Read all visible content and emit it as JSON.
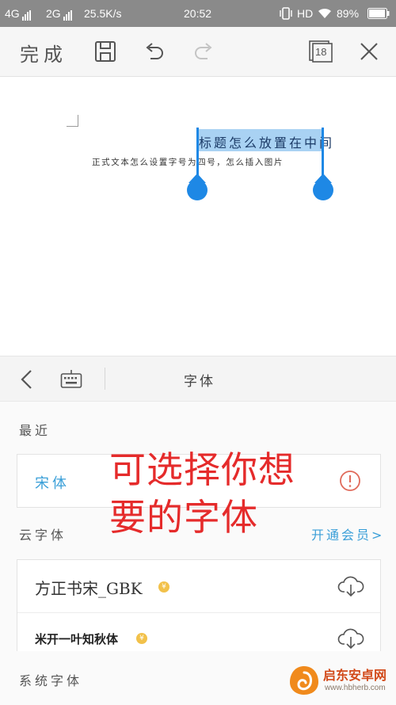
{
  "status_bar": {
    "signal1": "4G",
    "signal2": "2G",
    "speed": "25.5K/s",
    "time": "20:52",
    "hd": "HD",
    "battery": "89%"
  },
  "toolbar": {
    "done_label": "完成",
    "page_count": "18"
  },
  "document": {
    "selected_text": "标题怎么放置在中间",
    "body_text": "正式文本怎么设置字号为四号，怎么插入图片"
  },
  "panel": {
    "title": "字体",
    "recent_label": "最近",
    "recent_font": "宋体",
    "cloud_label": "云字体",
    "member_link": "开通会员>",
    "cloud_fonts": [
      {
        "name": "方正书宋_GBK"
      },
      {
        "name": "米开一叶知秋体"
      }
    ],
    "system_label": "系统字体"
  },
  "annotation": {
    "line1": "可选择你想",
    "line2": "要的字体"
  },
  "watermark": {
    "brand": "启东安卓网",
    "url": "www.hbherb.com"
  },
  "colors": {
    "accent": "#3a9fd8",
    "selection": "#a9d2f3",
    "handle": "#1e88e5",
    "annotation": "#e52b2b",
    "warning": "#e06a5a"
  }
}
